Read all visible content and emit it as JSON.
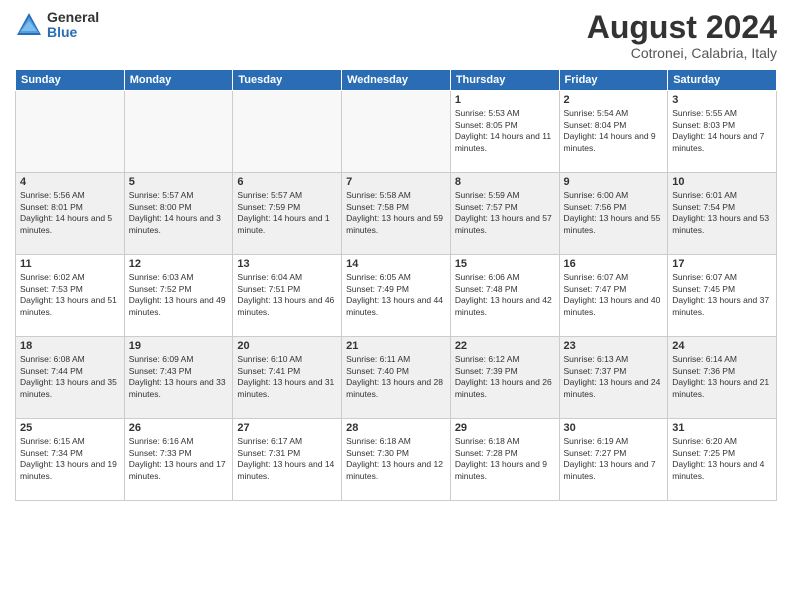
{
  "header": {
    "logo_general": "General",
    "logo_blue": "Blue",
    "month_year": "August 2024",
    "location": "Cotronei, Calabria, Italy"
  },
  "weekdays": [
    "Sunday",
    "Monday",
    "Tuesday",
    "Wednesday",
    "Thursday",
    "Friday",
    "Saturday"
  ],
  "weeks": [
    [
      {
        "day": "",
        "sunrise": "",
        "sunset": "",
        "daylight": "",
        "empty": true
      },
      {
        "day": "",
        "sunrise": "",
        "sunset": "",
        "daylight": "",
        "empty": true
      },
      {
        "day": "",
        "sunrise": "",
        "sunset": "",
        "daylight": "",
        "empty": true
      },
      {
        "day": "",
        "sunrise": "",
        "sunset": "",
        "daylight": "",
        "empty": true
      },
      {
        "day": "1",
        "sunrise": "Sunrise: 5:53 AM",
        "sunset": "Sunset: 8:05 PM",
        "daylight": "Daylight: 14 hours and 11 minutes.",
        "empty": false
      },
      {
        "day": "2",
        "sunrise": "Sunrise: 5:54 AM",
        "sunset": "Sunset: 8:04 PM",
        "daylight": "Daylight: 14 hours and 9 minutes.",
        "empty": false
      },
      {
        "day": "3",
        "sunrise": "Sunrise: 5:55 AM",
        "sunset": "Sunset: 8:03 PM",
        "daylight": "Daylight: 14 hours and 7 minutes.",
        "empty": false
      }
    ],
    [
      {
        "day": "4",
        "sunrise": "Sunrise: 5:56 AM",
        "sunset": "Sunset: 8:01 PM",
        "daylight": "Daylight: 14 hours and 5 minutes.",
        "empty": false
      },
      {
        "day": "5",
        "sunrise": "Sunrise: 5:57 AM",
        "sunset": "Sunset: 8:00 PM",
        "daylight": "Daylight: 14 hours and 3 minutes.",
        "empty": false
      },
      {
        "day": "6",
        "sunrise": "Sunrise: 5:57 AM",
        "sunset": "Sunset: 7:59 PM",
        "daylight": "Daylight: 14 hours and 1 minute.",
        "empty": false
      },
      {
        "day": "7",
        "sunrise": "Sunrise: 5:58 AM",
        "sunset": "Sunset: 7:58 PM",
        "daylight": "Daylight: 13 hours and 59 minutes.",
        "empty": false
      },
      {
        "day": "8",
        "sunrise": "Sunrise: 5:59 AM",
        "sunset": "Sunset: 7:57 PM",
        "daylight": "Daylight: 13 hours and 57 minutes.",
        "empty": false
      },
      {
        "day": "9",
        "sunrise": "Sunrise: 6:00 AM",
        "sunset": "Sunset: 7:56 PM",
        "daylight": "Daylight: 13 hours and 55 minutes.",
        "empty": false
      },
      {
        "day": "10",
        "sunrise": "Sunrise: 6:01 AM",
        "sunset": "Sunset: 7:54 PM",
        "daylight": "Daylight: 13 hours and 53 minutes.",
        "empty": false
      }
    ],
    [
      {
        "day": "11",
        "sunrise": "Sunrise: 6:02 AM",
        "sunset": "Sunset: 7:53 PM",
        "daylight": "Daylight: 13 hours and 51 minutes.",
        "empty": false
      },
      {
        "day": "12",
        "sunrise": "Sunrise: 6:03 AM",
        "sunset": "Sunset: 7:52 PM",
        "daylight": "Daylight: 13 hours and 49 minutes.",
        "empty": false
      },
      {
        "day": "13",
        "sunrise": "Sunrise: 6:04 AM",
        "sunset": "Sunset: 7:51 PM",
        "daylight": "Daylight: 13 hours and 46 minutes.",
        "empty": false
      },
      {
        "day": "14",
        "sunrise": "Sunrise: 6:05 AM",
        "sunset": "Sunset: 7:49 PM",
        "daylight": "Daylight: 13 hours and 44 minutes.",
        "empty": false
      },
      {
        "day": "15",
        "sunrise": "Sunrise: 6:06 AM",
        "sunset": "Sunset: 7:48 PM",
        "daylight": "Daylight: 13 hours and 42 minutes.",
        "empty": false
      },
      {
        "day": "16",
        "sunrise": "Sunrise: 6:07 AM",
        "sunset": "Sunset: 7:47 PM",
        "daylight": "Daylight: 13 hours and 40 minutes.",
        "empty": false
      },
      {
        "day": "17",
        "sunrise": "Sunrise: 6:07 AM",
        "sunset": "Sunset: 7:45 PM",
        "daylight": "Daylight: 13 hours and 37 minutes.",
        "empty": false
      }
    ],
    [
      {
        "day": "18",
        "sunrise": "Sunrise: 6:08 AM",
        "sunset": "Sunset: 7:44 PM",
        "daylight": "Daylight: 13 hours and 35 minutes.",
        "empty": false
      },
      {
        "day": "19",
        "sunrise": "Sunrise: 6:09 AM",
        "sunset": "Sunset: 7:43 PM",
        "daylight": "Daylight: 13 hours and 33 minutes.",
        "empty": false
      },
      {
        "day": "20",
        "sunrise": "Sunrise: 6:10 AM",
        "sunset": "Sunset: 7:41 PM",
        "daylight": "Daylight: 13 hours and 31 minutes.",
        "empty": false
      },
      {
        "day": "21",
        "sunrise": "Sunrise: 6:11 AM",
        "sunset": "Sunset: 7:40 PM",
        "daylight": "Daylight: 13 hours and 28 minutes.",
        "empty": false
      },
      {
        "day": "22",
        "sunrise": "Sunrise: 6:12 AM",
        "sunset": "Sunset: 7:39 PM",
        "daylight": "Daylight: 13 hours and 26 minutes.",
        "empty": false
      },
      {
        "day": "23",
        "sunrise": "Sunrise: 6:13 AM",
        "sunset": "Sunset: 7:37 PM",
        "daylight": "Daylight: 13 hours and 24 minutes.",
        "empty": false
      },
      {
        "day": "24",
        "sunrise": "Sunrise: 6:14 AM",
        "sunset": "Sunset: 7:36 PM",
        "daylight": "Daylight: 13 hours and 21 minutes.",
        "empty": false
      }
    ],
    [
      {
        "day": "25",
        "sunrise": "Sunrise: 6:15 AM",
        "sunset": "Sunset: 7:34 PM",
        "daylight": "Daylight: 13 hours and 19 minutes.",
        "empty": false
      },
      {
        "day": "26",
        "sunrise": "Sunrise: 6:16 AM",
        "sunset": "Sunset: 7:33 PM",
        "daylight": "Daylight: 13 hours and 17 minutes.",
        "empty": false
      },
      {
        "day": "27",
        "sunrise": "Sunrise: 6:17 AM",
        "sunset": "Sunset: 7:31 PM",
        "daylight": "Daylight: 13 hours and 14 minutes.",
        "empty": false
      },
      {
        "day": "28",
        "sunrise": "Sunrise: 6:18 AM",
        "sunset": "Sunset: 7:30 PM",
        "daylight": "Daylight: 13 hours and 12 minutes.",
        "empty": false
      },
      {
        "day": "29",
        "sunrise": "Sunrise: 6:18 AM",
        "sunset": "Sunset: 7:28 PM",
        "daylight": "Daylight: 13 hours and 9 minutes.",
        "empty": false
      },
      {
        "day": "30",
        "sunrise": "Sunrise: 6:19 AM",
        "sunset": "Sunset: 7:27 PM",
        "daylight": "Daylight: 13 hours and 7 minutes.",
        "empty": false
      },
      {
        "day": "31",
        "sunrise": "Sunrise: 6:20 AM",
        "sunset": "Sunset: 7:25 PM",
        "daylight": "Daylight: 13 hours and 4 minutes.",
        "empty": false
      }
    ]
  ]
}
